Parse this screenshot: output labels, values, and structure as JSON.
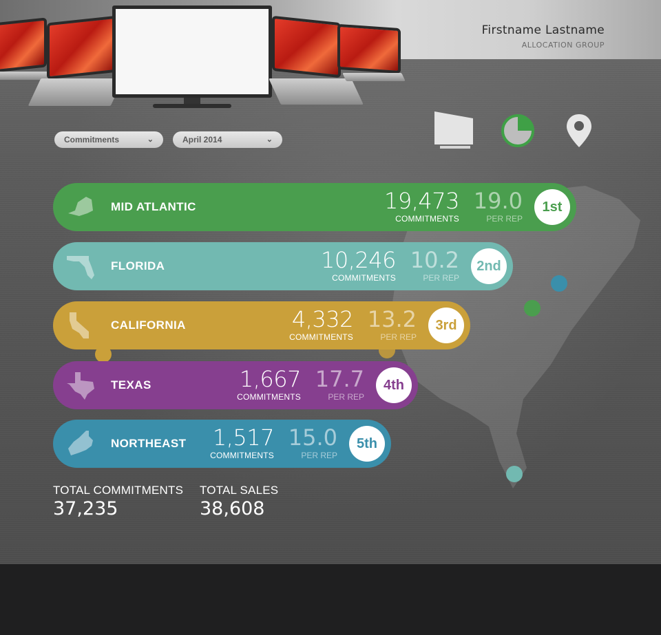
{
  "user": {
    "name": "Firstname Lastname",
    "group": "ALLOCATION GROUP"
  },
  "filters": {
    "metric": "Commitments",
    "period": "April 2014"
  },
  "view_icons": [
    "device-icon",
    "pie-chart-icon",
    "map-pin-icon"
  ],
  "colors": {
    "mid_atlantic": "#4a9e4e",
    "florida": "#72b9b1",
    "california": "#caa03a",
    "texas": "#863f8f",
    "northeast": "#3a8fab"
  },
  "rankings": [
    {
      "region": "MID ATLANTIC",
      "commitments": "19,473",
      "commitments_label": "COMMITMENTS",
      "per_rep": "19.0",
      "per_rep_label": "PER REP",
      "rank": "1st",
      "icon": "new-york-state-icon"
    },
    {
      "region": "FLORIDA",
      "commitments": "10,246",
      "commitments_label": "COMMITMENTS",
      "per_rep": "10.2",
      "per_rep_label": "PER REP",
      "rank": "2nd",
      "icon": "florida-state-icon"
    },
    {
      "region": "CALIFORNIA",
      "commitments": "4,332",
      "commitments_label": "COMMITMENTS",
      "per_rep": "13.2",
      "per_rep_label": "PER REP",
      "rank": "3rd",
      "icon": "california-state-icon"
    },
    {
      "region": "TEXAS",
      "commitments": "1,667",
      "commitments_label": "COMMITMENTS",
      "per_rep": "17.7",
      "per_rep_label": "PER REP",
      "rank": "4th",
      "icon": "texas-state-icon"
    },
    {
      "region": "NORTHEAST",
      "commitments": "1,517",
      "commitments_label": "COMMITMENTS",
      "per_rep": "15.0",
      "per_rep_label": "PER REP",
      "rank": "5th",
      "icon": "northeast-states-icon"
    }
  ],
  "totals": {
    "commitments_label": "TOTAL COMMITMENTS",
    "commitments_value": "37,235",
    "sales_label": "TOTAL SALES",
    "sales_value": "38,608"
  }
}
